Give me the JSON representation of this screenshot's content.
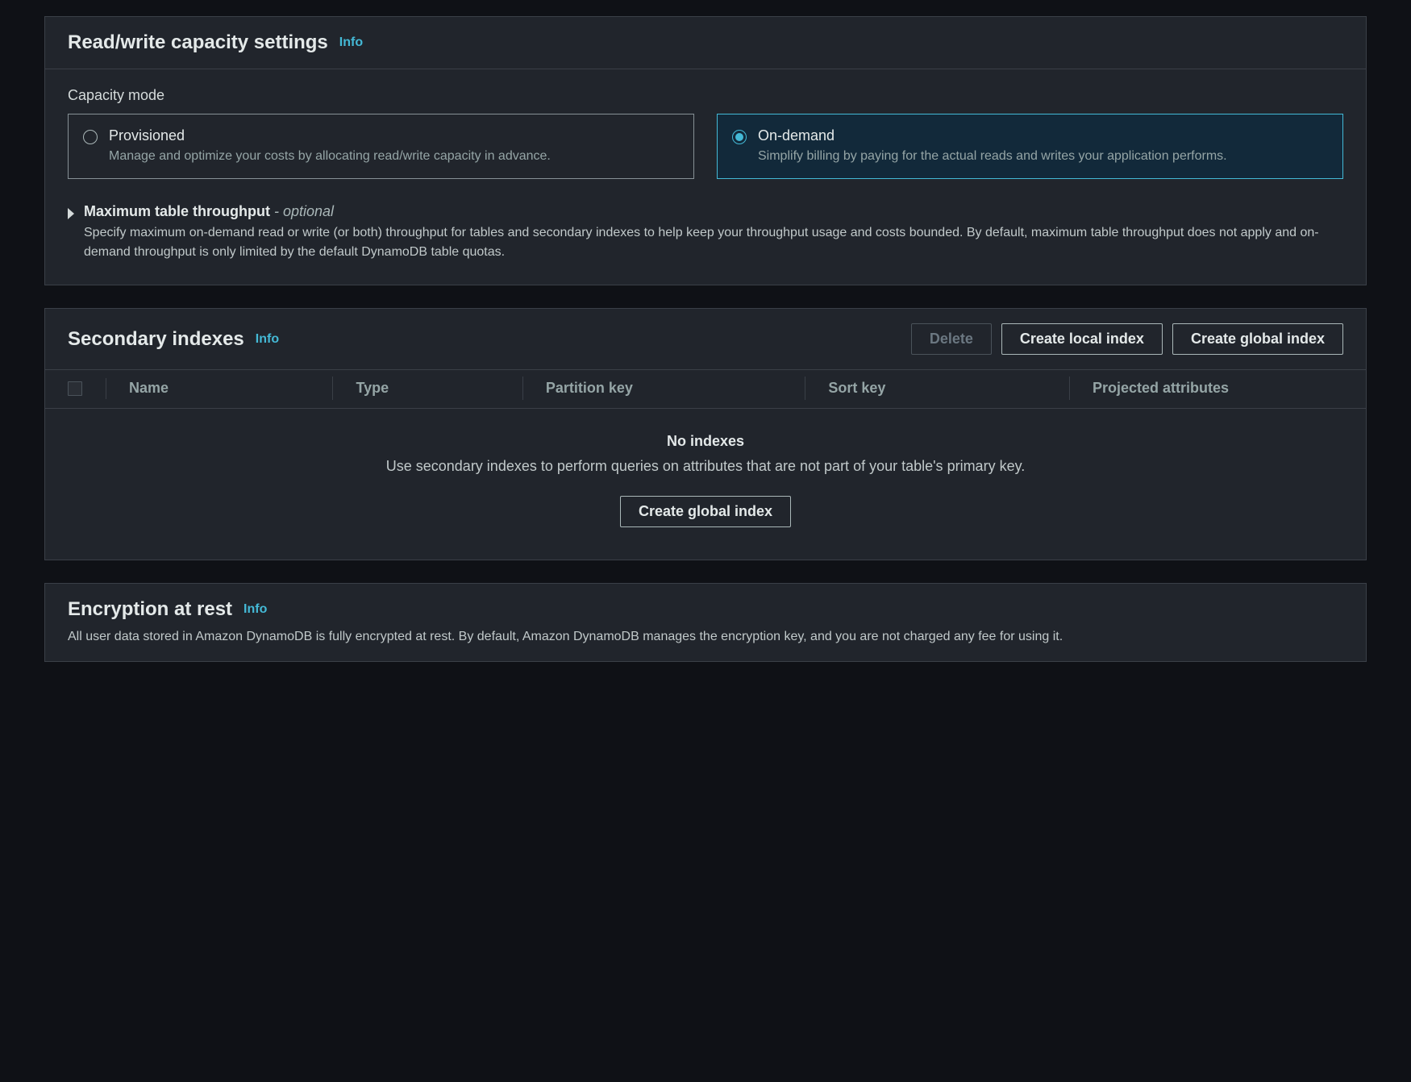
{
  "capacity": {
    "title": "Read/write capacity settings",
    "info": "Info",
    "mode_label": "Capacity mode",
    "options": {
      "provisioned": {
        "title": "Provisioned",
        "desc": "Manage and optimize your costs by allocating read/write capacity in advance."
      },
      "ondemand": {
        "title": "On-demand",
        "desc": "Simplify billing by paying for the actual reads and writes your application performs."
      }
    },
    "throughput": {
      "title": "Maximum table throughput",
      "optional_suffix": " - optional",
      "desc": "Specify maximum on-demand read or write (or both) throughput for tables and secondary indexes to help keep your throughput usage and costs bounded. By default, maximum table throughput does not apply and on-demand throughput is only limited by the default DynamoDB table quotas."
    }
  },
  "indexes": {
    "title": "Secondary indexes",
    "info": "Info",
    "buttons": {
      "delete": "Delete",
      "create_local": "Create local index",
      "create_global": "Create global index"
    },
    "columns": {
      "name": "Name",
      "type": "Type",
      "partition_key": "Partition key",
      "sort_key": "Sort key",
      "projected": "Projected attributes"
    },
    "empty": {
      "title": "No indexes",
      "desc": "Use secondary indexes to perform queries on attributes that are not part of your table's primary key.",
      "button": "Create global index"
    }
  },
  "encryption": {
    "title": "Encryption at rest",
    "info": "Info",
    "desc": "All user data stored in Amazon DynamoDB is fully encrypted at rest. By default, Amazon DynamoDB manages the encryption key, and you are not charged any fee for using it."
  }
}
